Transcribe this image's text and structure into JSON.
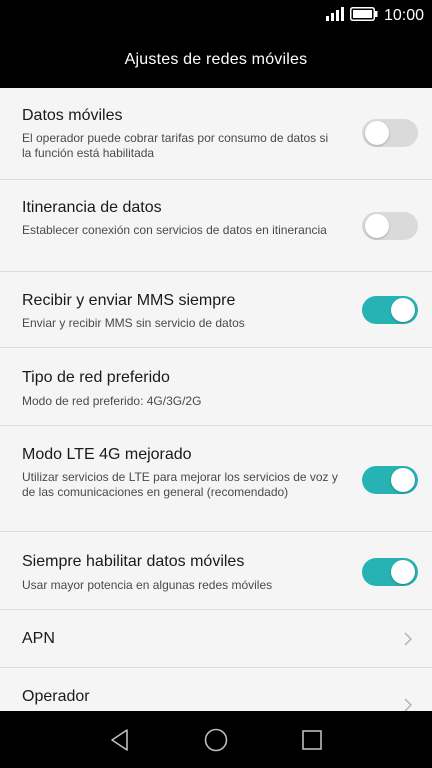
{
  "status_bar": {
    "time": "10:00",
    "icons": [
      "signal-icon",
      "battery-icon"
    ]
  },
  "header": {
    "title": "Ajustes de redes móviles"
  },
  "settings": [
    {
      "title": "Datos móviles",
      "subtitle": "El operador puede cobrar tarifas por consumo de datos si la función está habilitada",
      "control": "toggle",
      "enabled": false
    },
    {
      "title": "Itinerancia de datos",
      "subtitle": "Establecer conexión con servicios de datos en itinerancia",
      "control": "toggle",
      "enabled": false
    },
    {
      "title": "Recibir y enviar MMS siempre",
      "subtitle": "Enviar y recibir MMS sin servicio de datos",
      "control": "toggle",
      "enabled": true
    },
    {
      "title": "Tipo de red preferido",
      "subtitle": "Modo de red preferido: 4G/3G/2G",
      "control": "none"
    },
    {
      "title": "Modo LTE 4G mejorado",
      "subtitle": "Utilizar servicios de LTE para mejorar los servicios de voz y de las comunicaciones en general (recomendado)",
      "control": "toggle",
      "enabled": true
    },
    {
      "title": "Siempre habilitar datos móviles",
      "subtitle": "Usar mayor potencia en algunas redes móviles",
      "control": "toggle",
      "enabled": true
    },
    {
      "title": "APN",
      "control": "chevron"
    },
    {
      "title": "Operador",
      "control": "chevron"
    }
  ],
  "nav_bar": {
    "buttons": [
      "back-icon",
      "home-icon",
      "recents-icon"
    ]
  },
  "colors": {
    "accent": "#27b2b4",
    "toggle_off": "#dadada",
    "bar_background": "#000000",
    "list_background": "#f5f5f5"
  }
}
